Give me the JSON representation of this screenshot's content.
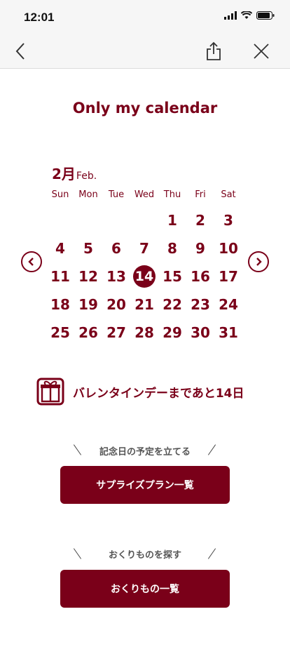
{
  "status": {
    "time": "12:01"
  },
  "title": "Only my calendar",
  "calendar": {
    "month_ja": "2月",
    "month_en": "Feb.",
    "weekdays": [
      "Sun",
      "Mon",
      "Tue",
      "Wed",
      "Thu",
      "Fri",
      "Sat"
    ],
    "days": [
      "",
      "",
      "",
      "",
      "1",
      "2",
      "3",
      "4",
      "5",
      "6",
      "7",
      "8",
      "9",
      "10",
      "11",
      "12",
      "13",
      "14",
      "15",
      "16",
      "17",
      "18",
      "19",
      "20",
      "21",
      "22",
      "23",
      "24",
      "25",
      "26",
      "27",
      "28",
      "29",
      "30",
      "31"
    ],
    "today": "14"
  },
  "countdown_text": "バレンタインデーまであと14日",
  "section1": {
    "heading": "記念日の予定を立てる",
    "button": "サプライズプラン一覧"
  },
  "section2": {
    "heading": "おくりものを探す",
    "button": "おくりもの一覧"
  },
  "colors": {
    "accent": "#7a0019",
    "bar": "#f6f6f6"
  },
  "icons": [
    "back-icon",
    "share-icon",
    "close-icon",
    "prev-month-icon",
    "next-month-icon",
    "gift-icon"
  ]
}
